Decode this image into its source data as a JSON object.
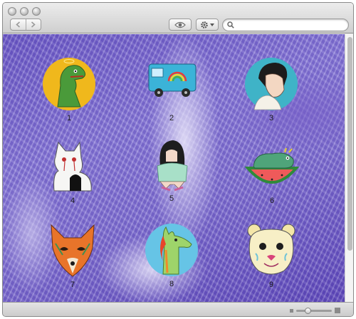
{
  "toolbar": {
    "back_icon": "chevron-left-icon",
    "forward_icon": "chevron-right-icon",
    "view_icon": "eye-icon",
    "action_icon": "gear-icon",
    "search": {
      "placeholder": "",
      "value": ""
    }
  },
  "items": [
    {
      "label": "1",
      "subject": "green dinosaur on yellow circle"
    },
    {
      "label": "2",
      "subject": "blue van with rainbow"
    },
    {
      "label": "3",
      "subject": "girl with black hair on teal circle"
    },
    {
      "label": "4",
      "subject": "white cat with bloody eyes"
    },
    {
      "label": "5",
      "subject": "crouching girl with long black hair"
    },
    {
      "label": "6",
      "subject": "green creature on watermelon slice"
    },
    {
      "label": "7",
      "subject": "fox mask"
    },
    {
      "label": "8",
      "subject": "llama on blue circle"
    },
    {
      "label": "9",
      "subject": "bear mask"
    }
  ],
  "colors": {
    "background_purple": "#6a57c4",
    "item1_circle": "#f0b81c",
    "item3_circle": "#3fb3c7",
    "item8_circle": "#66c4e6"
  },
  "icon_size_slider": {
    "level": 0.3
  }
}
